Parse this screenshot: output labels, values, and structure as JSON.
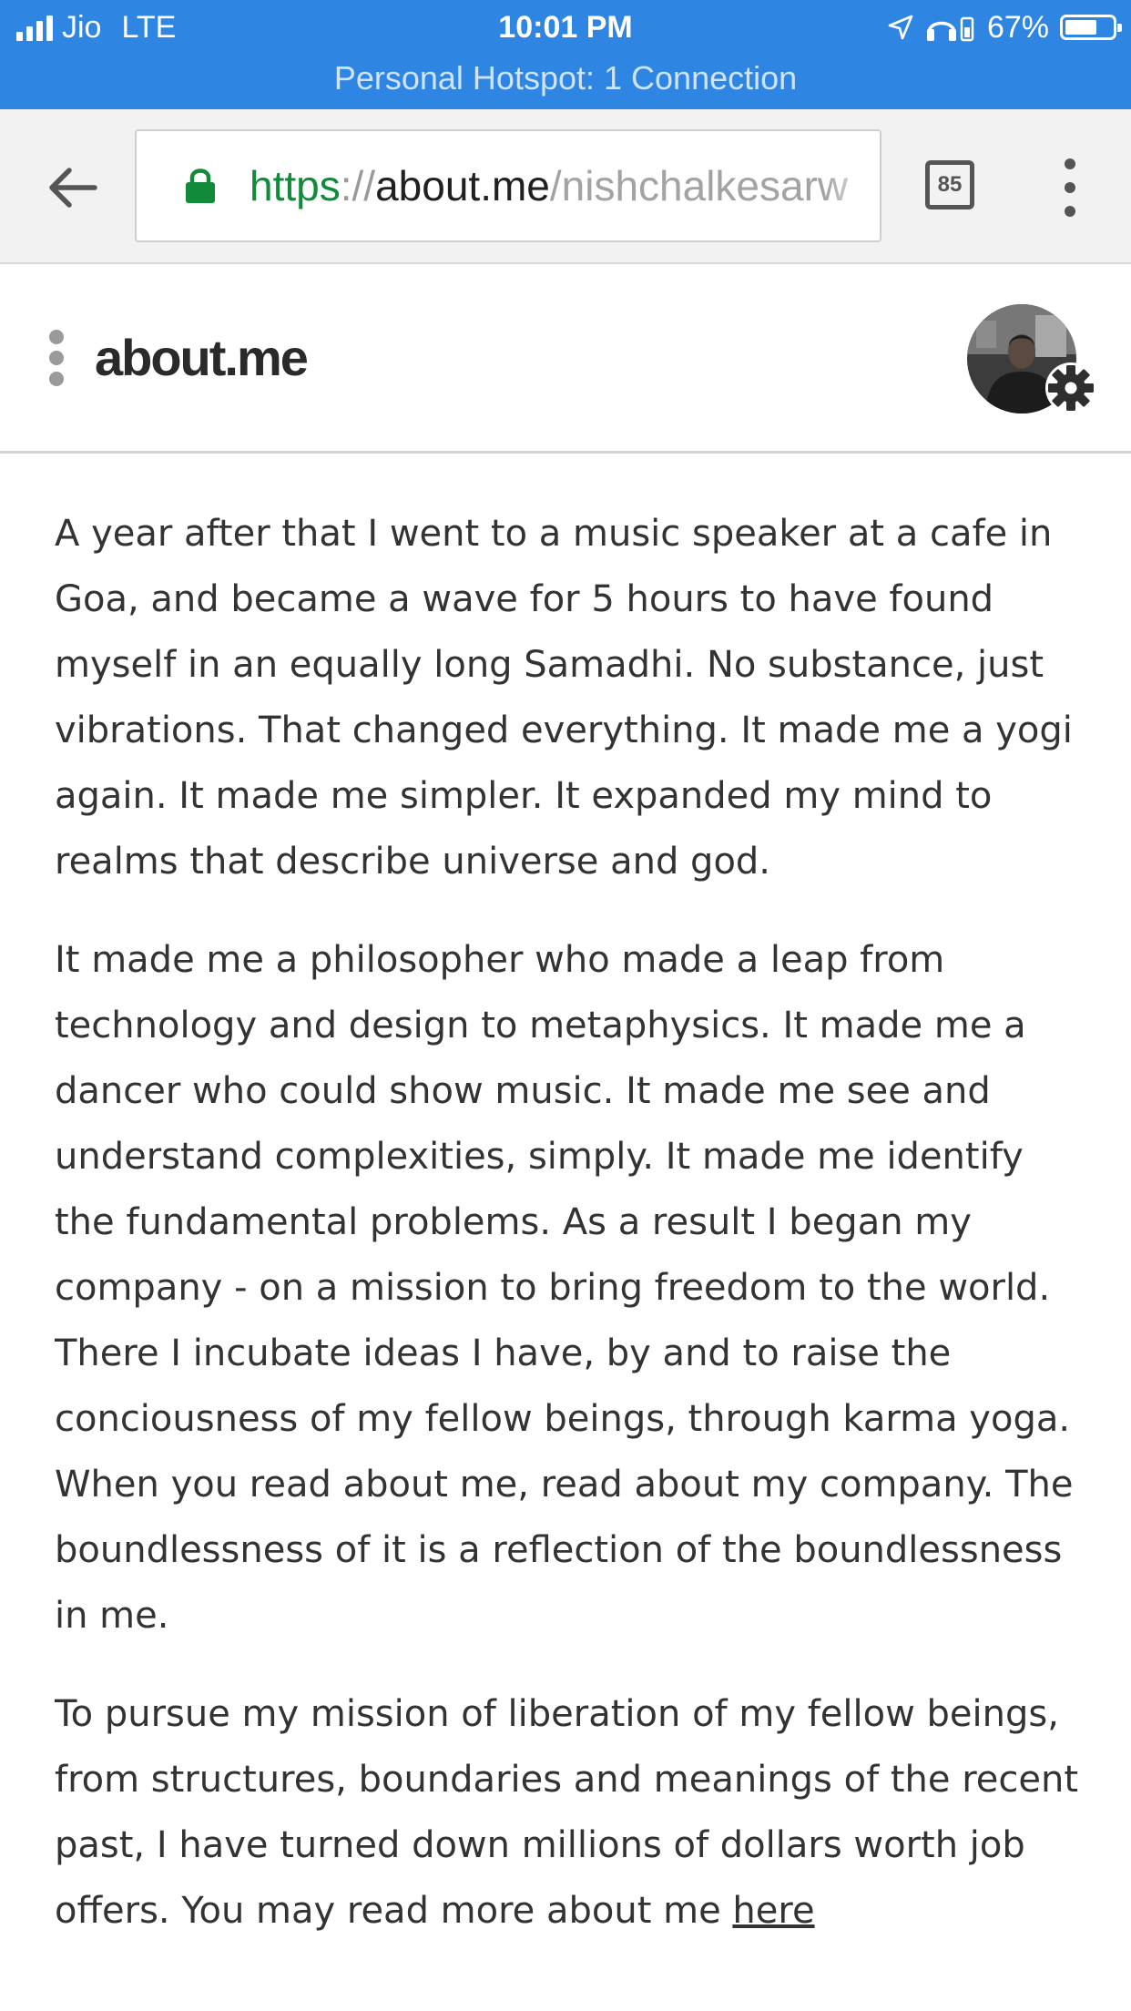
{
  "status_bar": {
    "carrier": "Jio",
    "network": "LTE",
    "time": "10:01 PM",
    "battery_percent": "67%",
    "battery_level": 0.67,
    "hotspot_text": "Personal Hotspot: 1 Connection",
    "icons": [
      "signal-icon",
      "location-icon",
      "headphones-icon",
      "battery-icon"
    ]
  },
  "browser": {
    "url_scheme": "https",
    "url_separator": "://",
    "url_host": "about.me",
    "url_path": "/nishchalkesarw",
    "tab_count": "85",
    "icons": [
      "back-arrow-icon",
      "lock-icon",
      "tabs-icon",
      "overflow-menu-icon"
    ]
  },
  "site": {
    "logo": "about.me",
    "icons": [
      "menu-dots-icon",
      "avatar",
      "gear-icon"
    ]
  },
  "content": {
    "paragraph_1": "A year after that I went to a music speaker at a cafe in Goa, and became a wave for 5 hours to have found myself in an equally long Samadhi. No substance, just vibrations. That changed everything. It made me a yogi again. It made me simpler. It expanded my mind to realms that describe universe and god.",
    "paragraph_2": "It made me a philosopher who made a leap from technology and design to metaphysics. It made me a dancer who could show music. It made me see and understand complexities, simply. It made me identify the fundamental problems. As a result I began my company - on a mission to bring freedom to the world. There I incubate ideas I have, by and to raise the conciousness of my fellow beings, through karma yoga. When you read about me, read about my company. The boundlessness of it is a reflection of the boundlessness in me.",
    "paragraph_3": "To pursue my mission of liberation of my fellow beings, from structures, boundaries and meanings of the recent past, I have turned down millions of dollars worth job offers. You may read more about me",
    "paragraph_3_link": "here"
  },
  "colors": {
    "status_bar_bg": "#2f86e2",
    "url_scheme": "#118a3a",
    "text": "#333333"
  }
}
